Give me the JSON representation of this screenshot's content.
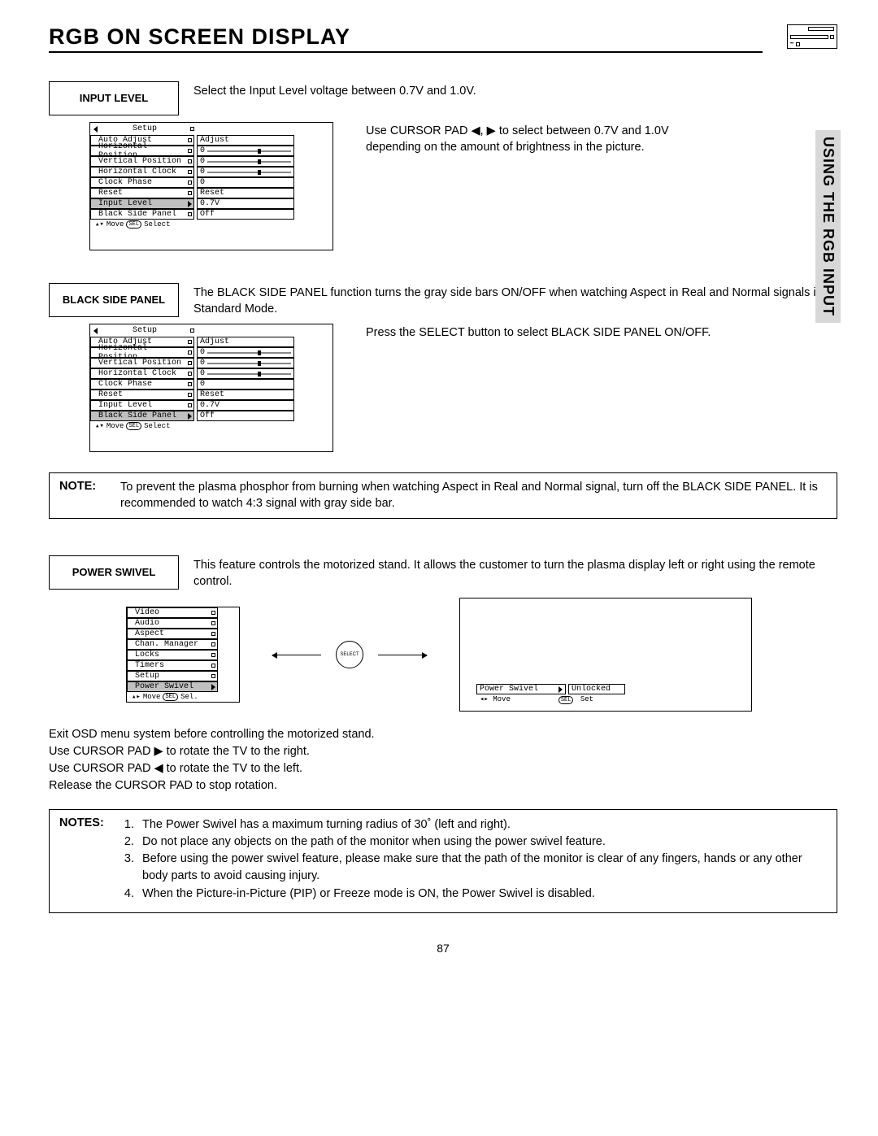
{
  "page_title": "RGB ON SCREEN DISPLAY",
  "side_tab": "USING THE RGB INPUT",
  "page_number": "87",
  "input_level": {
    "label": "INPUT LEVEL",
    "desc": "Select the Input Level voltage between 0.7V and 1.0V.",
    "right_text": "Use CURSOR PAD ◀, ▶ to select between 0.7V and 1.0V depending on the amount of brightness in the picture.",
    "osd": {
      "header": "Setup",
      "rows": [
        {
          "label": "Auto Adjust",
          "val": "Adjust",
          "slider": false
        },
        {
          "label": "Horizontal Position",
          "val": "0",
          "slider": true
        },
        {
          "label": "Vertical Position",
          "val": "0",
          "slider": true
        },
        {
          "label": "Horizontal Clock",
          "val": "0",
          "slider": true
        },
        {
          "label": "Clock Phase",
          "val": "0",
          "slider": false
        },
        {
          "label": "Reset",
          "val": "Reset",
          "slider": false
        },
        {
          "label": "Input Level",
          "val": "0.7V",
          "slider": false,
          "highlight": true,
          "arrow": true
        },
        {
          "label": "Black Side Panel",
          "val": "Off",
          "slider": false
        }
      ],
      "foot_move": "Move",
      "foot_sel": "SEL",
      "foot_select": "Select"
    }
  },
  "black_side_panel": {
    "label": "BLACK SIDE PANEL",
    "desc": "The BLACK SIDE PANEL function turns the gray side bars ON/OFF when watching Aspect in Real and Normal signals in Standard Mode.",
    "right_text": "Press the SELECT button to select BLACK SIDE PANEL ON/OFF.",
    "osd": {
      "header": "Setup",
      "rows": [
        {
          "label": "Auto Adjust",
          "val": "Adjust",
          "slider": false
        },
        {
          "label": "Horizontal Position",
          "val": "0",
          "slider": true
        },
        {
          "label": "Vertical Position",
          "val": "0",
          "slider": true
        },
        {
          "label": "Horizontal Clock",
          "val": "0",
          "slider": true
        },
        {
          "label": "Clock Phase",
          "val": "0",
          "slider": false
        },
        {
          "label": "Reset",
          "val": "Reset",
          "slider": false
        },
        {
          "label": "Input Level",
          "val": "0.7V",
          "slider": false
        },
        {
          "label": "Black Side Panel",
          "val": "Off",
          "slider": false,
          "highlight": true,
          "arrow": true
        }
      ],
      "foot_move": "Move",
      "foot_sel": "SEL",
      "foot_select": "Select"
    }
  },
  "note": {
    "label": "NOTE:",
    "text": "To prevent the plasma phosphor from burning when watching Aspect in Real and Normal signal, turn off the BLACK SIDE PANEL.  It is recommended to watch 4:3 signal with gray side bar."
  },
  "power_swivel": {
    "label": "POWER SWIVEL",
    "desc": "This feature controls the motorized stand.  It allows the customer to turn the plasma display left or right using the remote control.",
    "menu_items": [
      "Video",
      "Audio",
      "Aspect",
      "Chan. Manager",
      "Locks",
      "Timers",
      "Setup",
      "Power Swivel"
    ],
    "menu_foot_move": "Move",
    "menu_foot_sel": "SEL",
    "menu_foot_sel2": "Sel.",
    "ring": "SELECT",
    "result_label": "Power Swivel",
    "result_value": "Unlocked",
    "result_move": "Move",
    "result_sel": "SEL",
    "result_set": "Set",
    "instructions": [
      "Exit OSD menu system before controlling the motorized stand.",
      "Use CURSOR PAD ▶ to rotate the TV to the right.",
      "Use CURSOR PAD ◀ to rotate the TV to the left.",
      "Release the CURSOR PAD to stop rotation."
    ]
  },
  "notes": {
    "label": "NOTES:",
    "items": [
      "The Power Swivel has a maximum turning radius of 30˚ (left and right).",
      "Do not place any objects on the path of the monitor when using the power swivel feature.",
      "Before using the power swivel feature, please make sure that the path of the monitor is clear of any fingers, hands or any other body parts to avoid causing injury.",
      "When the Picture-in-Picture (PIP) or Freeze mode is ON, the Power Swivel is disabled."
    ]
  }
}
